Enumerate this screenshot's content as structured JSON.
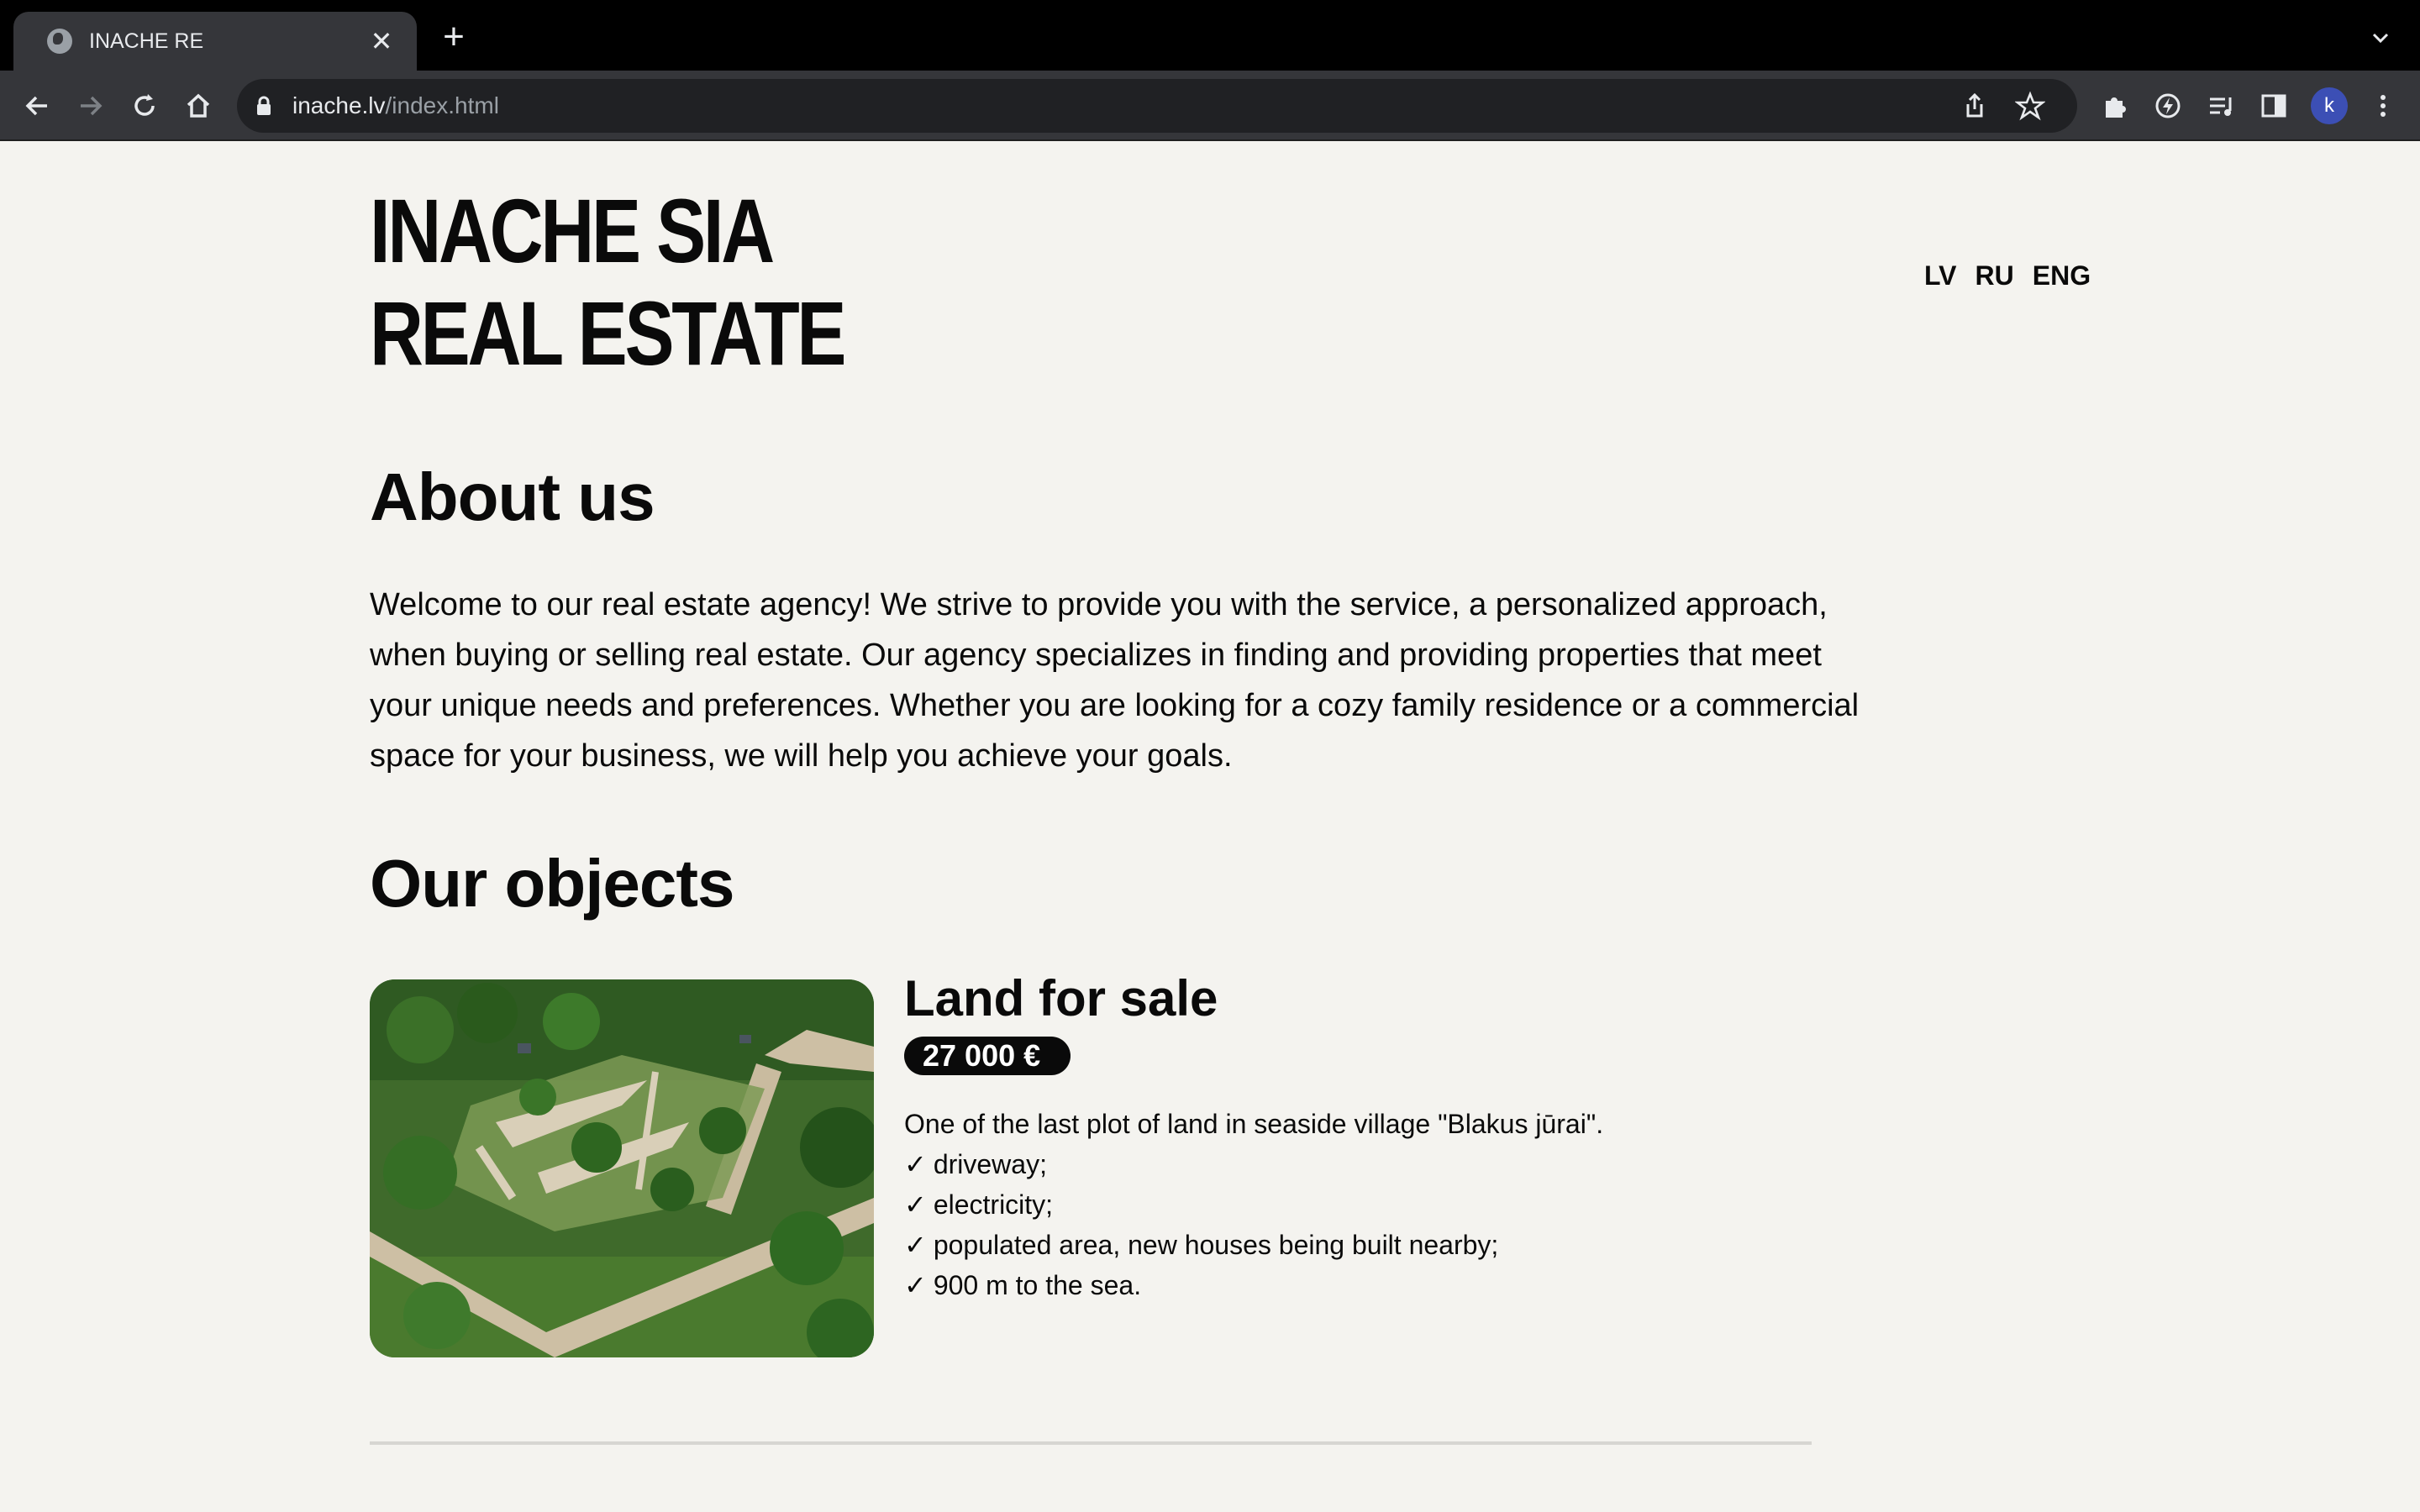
{
  "browser": {
    "tab_title": "INACHE RE",
    "tab_close": "✕",
    "new_tab": "+",
    "url_host": "inache.lv",
    "url_path": "/index.html",
    "profile_initial": "k"
  },
  "header": {
    "logo_line1": "INACHE SIA",
    "logo_line2": "REAL ESTATE",
    "languages": [
      "LV",
      "RU",
      "ENG"
    ]
  },
  "about": {
    "heading": "About us",
    "text": "Welcome to our real estate agency! We strive to provide you with the service, a personalized approach, when buying or selling real estate. Our agency specializes in finding and providing properties that meet your unique needs and preferences. Whether you are looking for a cozy family residence or a commercial space for your business, we will help you achieve your goals."
  },
  "objects": {
    "heading": "Our objects",
    "items": [
      {
        "title": "Land for sale",
        "price": "27 000 €",
        "description": "One of the last plot of land in seaside village \"Blakus jūrai\".",
        "check": "✓",
        "features": [
          "driveway;",
          "electricity;",
          "populated area, new houses being built nearby;",
          "900 m to the sea."
        ]
      }
    ]
  }
}
